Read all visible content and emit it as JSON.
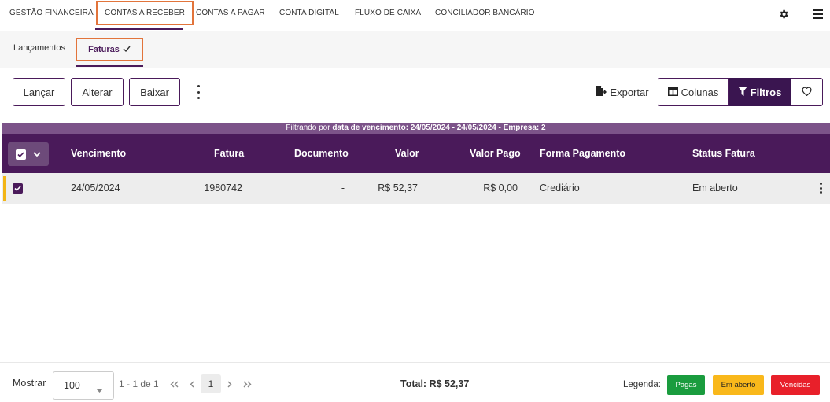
{
  "top_nav": {
    "tabs": [
      {
        "label": "GESTÃO FINANCEIRA"
      },
      {
        "label": "CONTAS A RECEBER"
      },
      {
        "label": "CONTAS A PAGAR"
      },
      {
        "label": "CONTA DIGITAL"
      },
      {
        "label": "FLUXO DE CAIXA"
      },
      {
        "label": "CONCILIADOR BANCÁRIO"
      }
    ],
    "icons": [
      "gear-icon",
      "hamburger-menu-icon"
    ]
  },
  "sub_nav": {
    "tabs": [
      {
        "label": "Lançamentos"
      },
      {
        "label": "Faturas"
      }
    ]
  },
  "toolbar": {
    "lancar": "Lançar",
    "alterar": "Alterar",
    "baixar": "Baixar",
    "exportar": "Exportar",
    "colunas": "Colunas",
    "filtros": "Filtros"
  },
  "filter_bar": {
    "prefix": "Filtrando por",
    "detail": "data de vencimento: 24/05/2024 - 24/05/2024 - Empresa: 2"
  },
  "table": {
    "headers": [
      "Vencimento",
      "Fatura",
      "Documento",
      "Valor",
      "Valor Pago",
      "Forma Pagamento",
      "Status Fatura"
    ],
    "rows": [
      {
        "vencimento": "24/05/2024",
        "fatura": "1980742",
        "documento": "-",
        "valor": "R$ 52,37",
        "valor_pago": "R$ 0,00",
        "forma_pagamento": "Crediário",
        "status": "Em aberto"
      }
    ]
  },
  "footer": {
    "mostrar_label": "Mostrar",
    "page_size": "100",
    "range_text": "1 - 1 de 1",
    "current_page": "1",
    "total": "Total: R$ 52,37",
    "legend_label": "Legenda:",
    "legend": [
      {
        "label": "Pagas",
        "color": "#1a9c3e"
      },
      {
        "label": "Em aberto",
        "color": "#f9b81b"
      },
      {
        "label": "Vencidas",
        "color": "#e8202a"
      }
    ]
  },
  "colors": {
    "primary": "#4a1a5a",
    "accent_outline": "#e2743b",
    "filter_bar": "#7c5389"
  }
}
